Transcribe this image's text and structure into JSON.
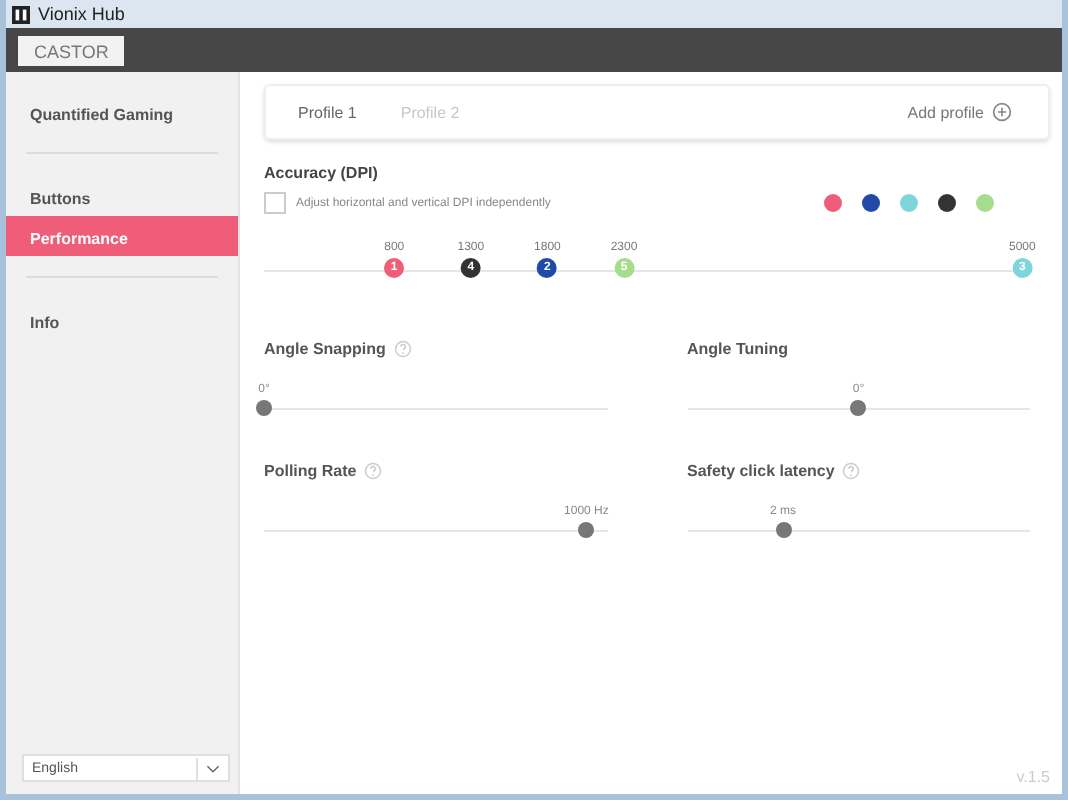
{
  "window": {
    "title": "Vionix Hub"
  },
  "device_tab": {
    "label": "CASTOR"
  },
  "sidebar": {
    "items": [
      {
        "label": "Quantified Gaming",
        "selected": false,
        "divider_after": true
      },
      {
        "label": "Buttons",
        "selected": false,
        "divider_after": false
      },
      {
        "label": "Performance",
        "selected": true,
        "divider_after": true
      },
      {
        "label": "Info",
        "selected": false,
        "divider_after": false
      }
    ],
    "language": {
      "value": "English"
    }
  },
  "profiles": {
    "tabs": [
      {
        "label": "Profile 1",
        "selected": true
      },
      {
        "label": "Profile 2",
        "selected": false
      }
    ],
    "add_label": "Add profile"
  },
  "accuracy": {
    "title": "Accuracy (DPI)",
    "checkbox": {
      "label": "Adjust horizontal and vertical DPI independently",
      "checked": false
    },
    "palette": [
      {
        "color": "#ef5d78"
      },
      {
        "color": "#1f4aa8"
      },
      {
        "color": "#7ed6dc"
      },
      {
        "color": "#333333"
      },
      {
        "color": "#a6dc8e"
      }
    ],
    "points": [
      {
        "value": "800",
        "number": "1",
        "color": "#ef5d78",
        "level": 0.17
      },
      {
        "value": "1300",
        "number": "4",
        "color": "#333333",
        "level": 0.27
      },
      {
        "value": "1800",
        "number": "2",
        "color": "#1f4aa8",
        "level": 0.37
      },
      {
        "value": "2300",
        "number": "5",
        "color": "#a6dc8e",
        "level": 0.47
      },
      {
        "value": "5000",
        "number": "3",
        "color": "#7ed6dc",
        "level": 0.99
      }
    ]
  },
  "settings": [
    {
      "title": "Angle Snapping",
      "help": true,
      "reading": "0°",
      "level": 0.0
    },
    {
      "title": "Angle Tuning",
      "help": false,
      "reading": "0°",
      "level": 0.5
    },
    {
      "title": "Polling Rate",
      "help": true,
      "reading": "1000 Hz",
      "level": 0.94
    },
    {
      "title": "Safety click latency",
      "help": true,
      "reading": "2 ms",
      "level": 0.28
    }
  ],
  "version": "v.1.5"
}
